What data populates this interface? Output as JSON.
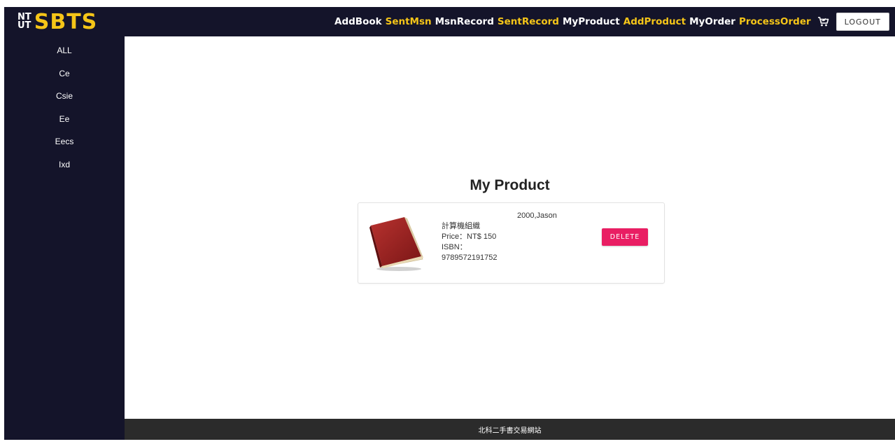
{
  "brand": {
    "logo_small_top": "NT",
    "logo_small_bottom": "UT",
    "logo_text": "SBTS",
    "accent_color": "#f5c518"
  },
  "nav": {
    "links": [
      {
        "label": "AddBook",
        "color": "white"
      },
      {
        "label": "SentMsn",
        "color": "yellow"
      },
      {
        "label": "MsnRecord",
        "color": "white"
      },
      {
        "label": "SentRecord",
        "color": "yellow"
      },
      {
        "label": "MyProduct",
        "color": "white"
      },
      {
        "label": "AddProduct",
        "color": "yellow"
      },
      {
        "label": "MyOrder",
        "color": "white"
      },
      {
        "label": "ProcessOrder",
        "color": "yellow"
      }
    ],
    "cart_icon": "cart-icon",
    "logout_label": "LOGOUT"
  },
  "sidebar": {
    "items": [
      {
        "label": "ALL"
      },
      {
        "label": "Ce"
      },
      {
        "label": "Csie"
      },
      {
        "label": "Ee"
      },
      {
        "label": "Eecs"
      },
      {
        "label": "Ixd"
      }
    ]
  },
  "main": {
    "title": "My Product",
    "products": [
      {
        "seller": "2000,Jason",
        "name": "計算機組織",
        "price": "Price：NT$ 150",
        "isbn_label": "ISBN：",
        "isbn": "9789572191752",
        "delete_label": "DELETE",
        "icon": "book-icon"
      }
    ]
  },
  "footer": {
    "text": "北科二手書交易網站"
  },
  "colors": {
    "dark_bg": "#14142a",
    "delete": "#e91e63",
    "footer_bg": "#2b2b2b"
  }
}
